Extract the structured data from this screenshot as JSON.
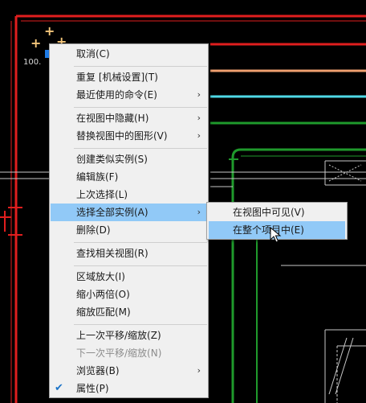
{
  "canvas_annotation": "100.",
  "context_menu": {
    "items": [
      {
        "label": "取消(C)"
      },
      {
        "label": "重复 [机械设置](T)"
      },
      {
        "label": "最近使用的命令(E)",
        "submenu": true
      },
      {
        "label": "在视图中隐藏(H)",
        "submenu": true
      },
      {
        "label": "替换视图中的图形(V)",
        "submenu": true
      },
      {
        "label": "创建类似实例(S)"
      },
      {
        "label": "编辑族(F)"
      },
      {
        "label": "上次选择(L)"
      },
      {
        "label": "选择全部实例(A)",
        "submenu": true,
        "highlighted": true
      },
      {
        "label": "删除(D)"
      },
      {
        "label": "查找相关视图(R)"
      },
      {
        "label": "区域放大(I)"
      },
      {
        "label": "缩小两倍(O)"
      },
      {
        "label": "缩放匹配(M)"
      },
      {
        "label": "上一次平移/缩放(Z)"
      },
      {
        "label": "下一次平移/缩放(N)",
        "disabled": true
      },
      {
        "label": "浏览器(B)",
        "submenu": true
      },
      {
        "label": "属性(P)",
        "checked": true
      }
    ],
    "arrow_glyph": "›",
    "check_glyph": "✔"
  },
  "submenu": {
    "items": [
      {
        "label": "在视图中可见(V)"
      },
      {
        "label": "在整个项目中(E)",
        "highlighted": true
      }
    ]
  },
  "colors": {
    "menu_bg": "#f0f0f0",
    "highlight": "#91c9f7",
    "cad_red": "#e01e1e",
    "cad_green": "#1f9a2c",
    "cad_cyan": "#4fd9e6",
    "cad_orange": "#f0a070",
    "cad_white": "#d0d0d0"
  }
}
